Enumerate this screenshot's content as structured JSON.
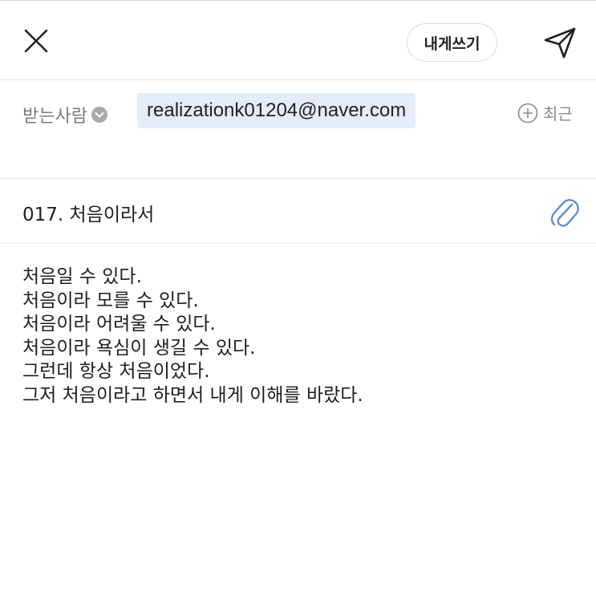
{
  "header": {
    "self_write_label": "내게쓰기"
  },
  "recipient": {
    "label": "받는사람",
    "email": "realizationk01204@naver.com",
    "recent_label": "최근"
  },
  "subject": {
    "text": "017. 처음이라서"
  },
  "body": {
    "lines": [
      "처음일 수 있다.",
      "처음이라 모를 수 있다.",
      "처음이라 어려울 수 있다.",
      "처음이라 욕심이 생길 수 있다.",
      "그런데 항상 처음이었다.",
      "그저 처음이라고 하면서 내게 이해를 바랐다."
    ]
  },
  "colors": {
    "chip_background": "#e5ecf8",
    "attach_icon": "#5f8fd0",
    "muted_text": "#7a7a7a"
  }
}
